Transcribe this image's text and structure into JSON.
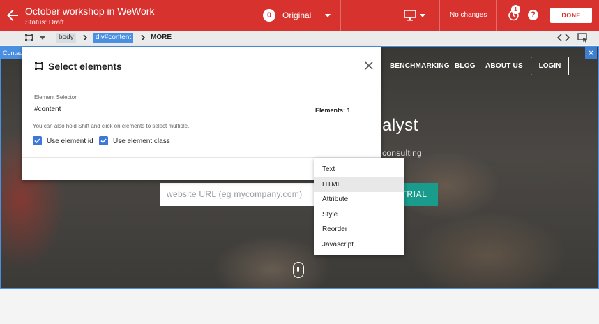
{
  "header": {
    "title": "October workshop in WeWork",
    "status": "Status: Draft",
    "variant_number": "0",
    "variant_name": "Original",
    "changes_text": "No changes",
    "notification_count": "1",
    "help_glyph": "?",
    "done_label": "DONE",
    "accent_color": "#d8322f"
  },
  "breadcrumb": {
    "items": [
      "body",
      "div#content",
      "MORE"
    ]
  },
  "site": {
    "selection_tag": "Contact",
    "nav": [
      "BENCHMARKING",
      "BLOG",
      "ABOUT US"
    ],
    "login_label": "LOGIN",
    "hero_title": "alyst",
    "hero_subtitle": "consulting",
    "url_placeholder": "website URL (eg mycompany.com)",
    "trial_label": "TRIAL",
    "trial_color": "#1a9c8c"
  },
  "dialog": {
    "title": "Select elements",
    "selector_label": "Element Selector",
    "selector_value": "#content",
    "elements_count": "Elements: 1",
    "hint": "You can also hold Shift and click on elements to select multiple.",
    "use_id_label": "Use element id",
    "use_class_label": "Use element class"
  },
  "menu": {
    "items": [
      "Text",
      "HTML",
      "Attribute",
      "Style",
      "Reorder",
      "Javascript"
    ],
    "highlighted": "HTML"
  },
  "icons": [
    "arrow-back-icon",
    "desktop-icon",
    "undo-icon",
    "help-icon",
    "selection-icon",
    "chevron-right-icon",
    "code-icon",
    "inspect-icon",
    "close-icon",
    "check-icon",
    "scroll-indicator-icon"
  ]
}
